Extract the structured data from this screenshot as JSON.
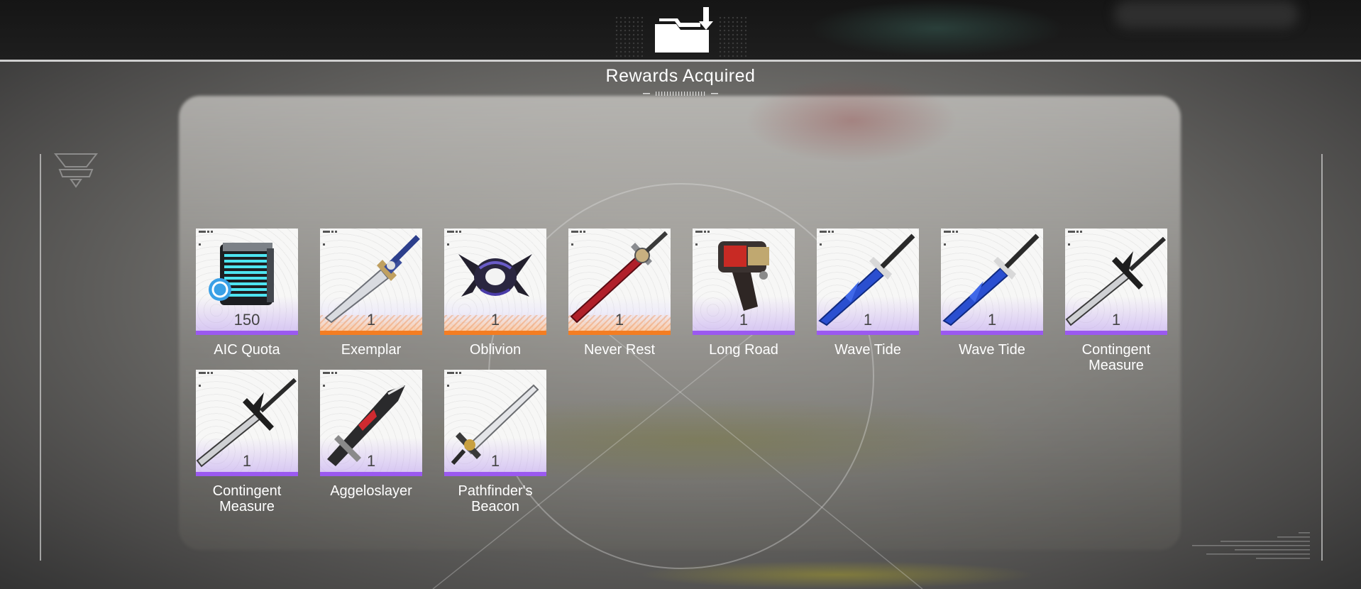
{
  "header": {
    "title": "Rewards Acquired"
  },
  "rewards": [
    {
      "name": "AIC Quota",
      "qty": "150",
      "rarity": "purple",
      "icon": "aic-quota-icon"
    },
    {
      "name": "Exemplar",
      "qty": "1",
      "rarity": "orange",
      "icon": "sword-icon"
    },
    {
      "name": "Oblivion",
      "qty": "1",
      "rarity": "orange",
      "icon": "arts-unit-icon"
    },
    {
      "name": "Never Rest",
      "qty": "1",
      "rarity": "orange",
      "icon": "sword-icon"
    },
    {
      "name": "Long Road",
      "qty": "1",
      "rarity": "purple",
      "icon": "handcannon-icon"
    },
    {
      "name": "Wave Tide",
      "qty": "1",
      "rarity": "purple",
      "icon": "sword-icon"
    },
    {
      "name": "Wave Tide",
      "qty": "1",
      "rarity": "purple",
      "icon": "sword-icon"
    },
    {
      "name": "Contingent Measure",
      "qty": "1",
      "rarity": "purple",
      "icon": "polearm-icon"
    },
    {
      "name": "Contingent Measure",
      "qty": "1",
      "rarity": "purple",
      "icon": "polearm-icon"
    },
    {
      "name": "Aggeloslayer",
      "qty": "1",
      "rarity": "purple",
      "icon": "sword-icon"
    },
    {
      "name": "Pathfinder's Beacon",
      "qty": "1",
      "rarity": "purple",
      "icon": "sword-icon"
    }
  ],
  "colors": {
    "purple": "#9b59f0",
    "orange": "#f47d22"
  }
}
